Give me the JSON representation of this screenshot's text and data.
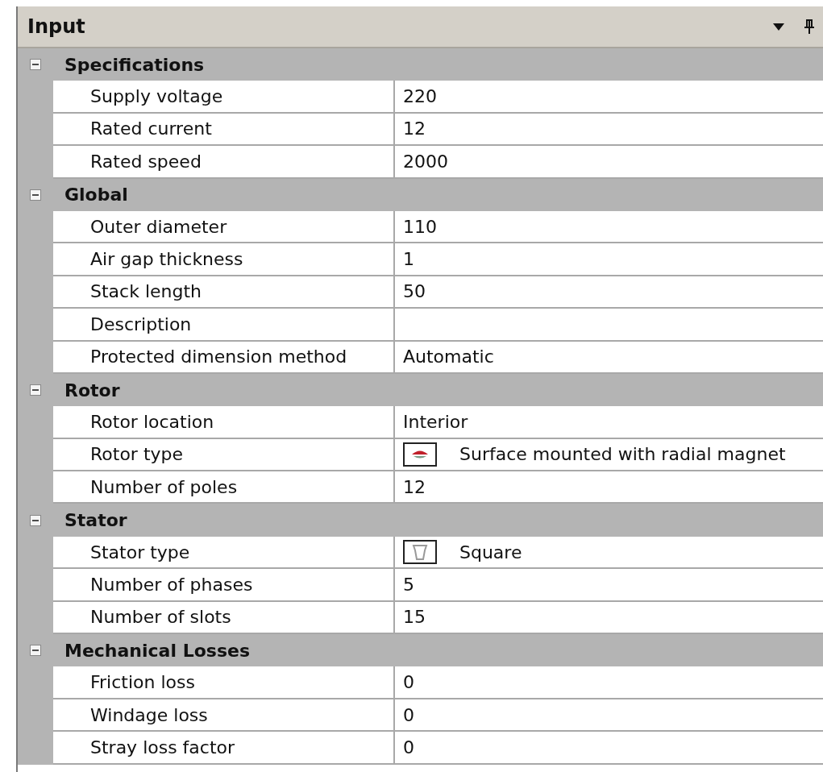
{
  "panel": {
    "title": "Input"
  },
  "categories": [
    {
      "label": "Specifications",
      "expanded": true,
      "properties": [
        {
          "name": "Supply voltage",
          "value": "220"
        },
        {
          "name": "Rated current",
          "value": "12"
        },
        {
          "name": "Rated speed",
          "value": "2000"
        }
      ]
    },
    {
      "label": "Global",
      "expanded": true,
      "properties": [
        {
          "name": "Outer diameter",
          "value": "110"
        },
        {
          "name": "Air gap thickness",
          "value": "1"
        },
        {
          "name": "Stack length",
          "value": "50"
        },
        {
          "name": "Description"
        },
        {
          "name": "Protected dimension method",
          "value": "Automatic"
        }
      ]
    },
    {
      "label": "Rotor",
      "expanded": true,
      "properties": [
        {
          "name": "Rotor location",
          "value": "Interior"
        },
        {
          "name": "Rotor type",
          "value": "Surface mounted with radial magnet",
          "kind": "rotor"
        },
        {
          "name": "Number of poles",
          "value": "12"
        }
      ]
    },
    {
      "label": "Stator",
      "expanded": true,
      "properties": [
        {
          "name": "Stator type",
          "value": "Square",
          "kind": "stator"
        },
        {
          "name": "Number of phases",
          "value": "5"
        },
        {
          "name": "Number of slots",
          "value": "15"
        }
      ]
    },
    {
      "label": "Mechanical Losses",
      "expanded": true,
      "properties": [
        {
          "name": "Friction loss",
          "value": "0"
        },
        {
          "name": "Windage loss",
          "value": "0"
        },
        {
          "name": "Stray loss factor",
          "value": "0"
        }
      ]
    }
  ]
}
